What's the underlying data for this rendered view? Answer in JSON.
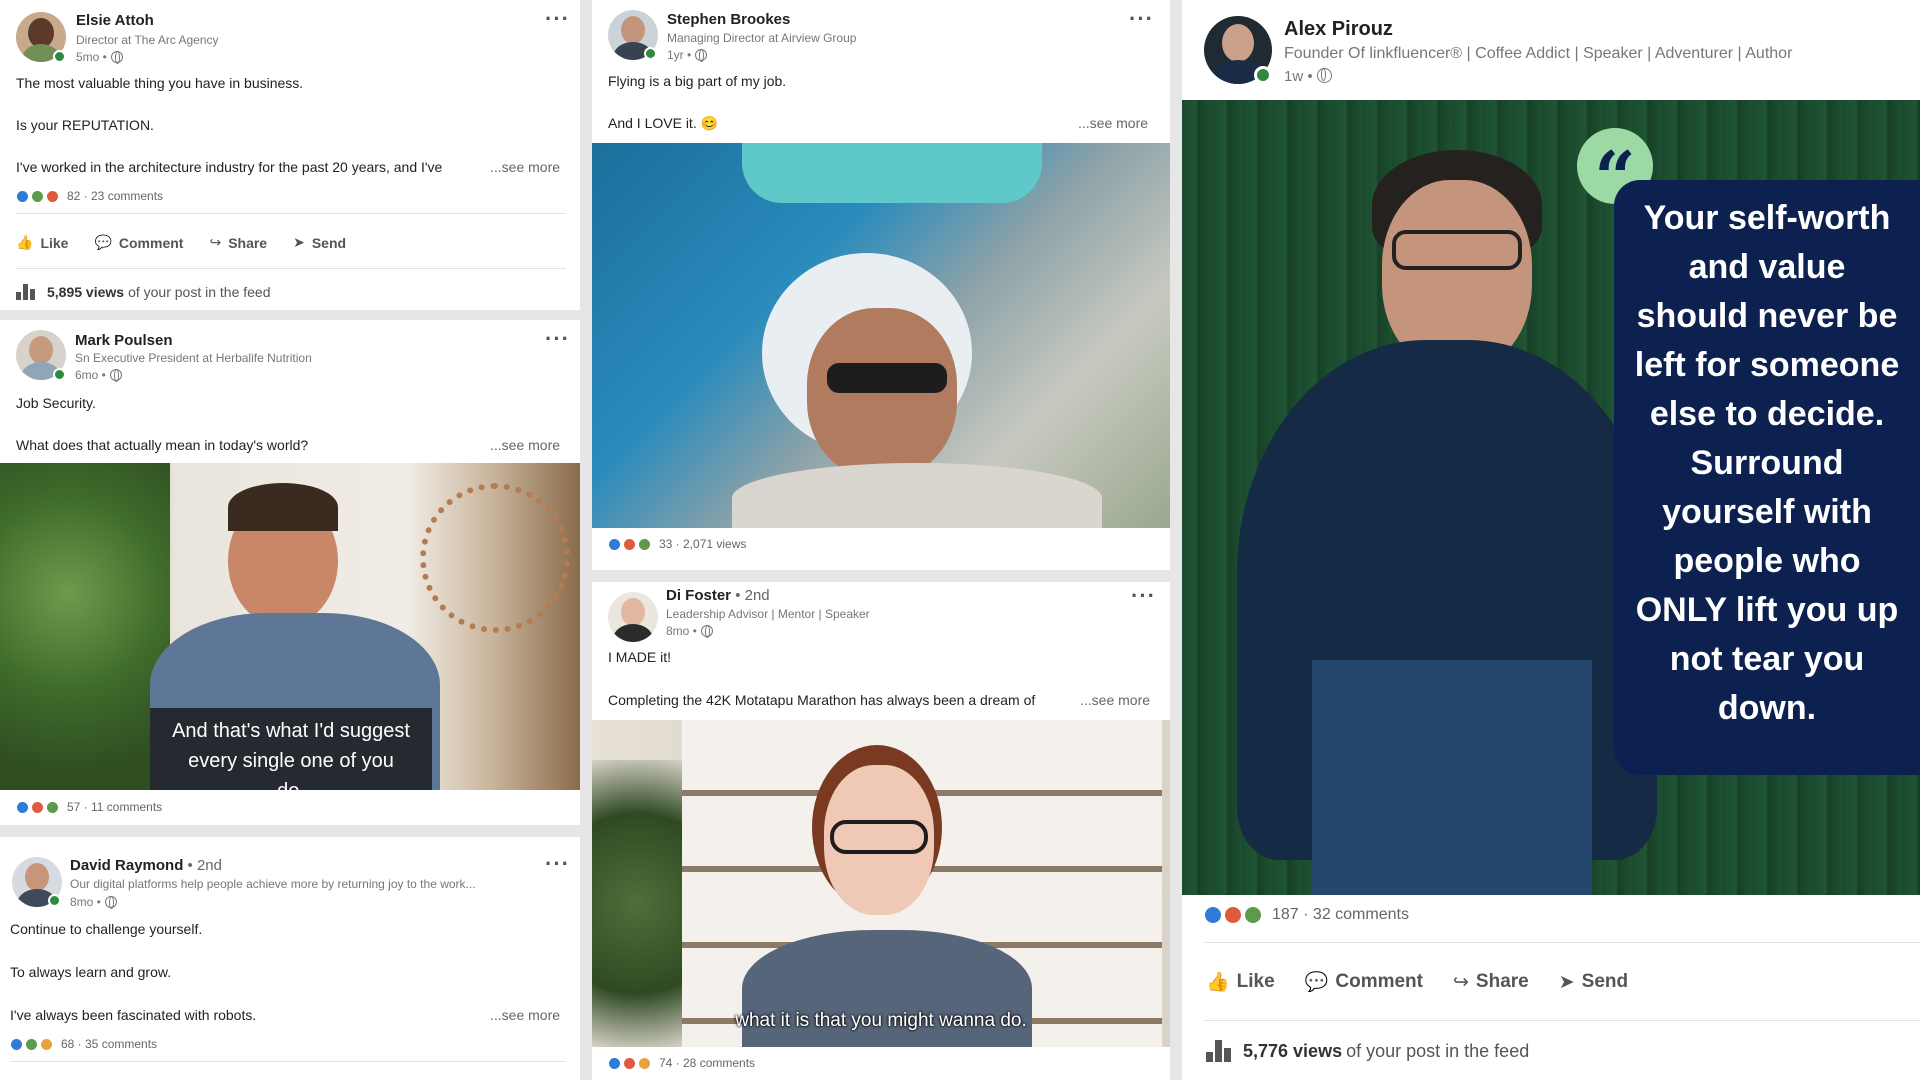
{
  "posts": [
    {
      "name": "Elsie Attoh",
      "headline": "Director at The Arc Agency",
      "time": "5mo •",
      "lines": [
        "The most valuable thing you have in business.",
        "Is your REPUTATION.",
        "I've worked in the architecture industry for the past 20 years, and I've"
      ],
      "see_more": "...see more",
      "reactions": "82 · 23 comments",
      "actions": [
        "Like",
        "Comment",
        "Share",
        "Send"
      ],
      "views_count": "5,895 views",
      "views_suffix": "of your post in the feed"
    },
    {
      "name": "Mark Poulsen",
      "headline": "Sn Executive President at Herbalife Nutrition",
      "time": "6mo •",
      "lines": [
        "Job Security.",
        "What does that actually mean in today's world?"
      ],
      "see_more": "...see more",
      "caption_1": "And that's what I'd suggest",
      "caption_2": "every single one of you do.",
      "reactions": "57 · 11 comments"
    },
    {
      "name": "David Raymond",
      "degree": "• 2nd",
      "headline": "Our digital platforms help people achieve more by returning joy to the work...",
      "time": "8mo •",
      "lines": [
        "Continue to challenge yourself.",
        "To always learn and grow.",
        "I've always been fascinated with robots."
      ],
      "see_more": "...see more",
      "reactions": "68 · 35 comments"
    },
    {
      "name": "Stephen Brookes",
      "headline": "Managing Director at Airview Group",
      "time": "1yr •",
      "lines": [
        "Flying is a big part of my job.",
        "And I LOVE it. 😊"
      ],
      "see_more": "...see more",
      "reactions": "33 · 2,071 views"
    },
    {
      "name": "Di Foster",
      "degree": "• 2nd",
      "headline": "Leadership Advisor | Mentor | Speaker",
      "time": "8mo •",
      "lines": [
        "I MADE it!",
        "Completing the 42K Motatapu Marathon has always been a dream of"
      ],
      "see_more": "...see more",
      "caption": "what it is that you might wanna do.",
      "reactions": "74 · 28 comments"
    },
    {
      "name": "Alex Pirouz",
      "headline": "Founder Of linkfluencer® | Coffee Addict | Speaker | Adventurer | Author",
      "time": "1w •",
      "quote": [
        "Your self-worth",
        "and value",
        "should never be",
        "left for someone",
        "else to decide.",
        "Surround",
        "yourself with",
        "people who",
        "ONLY lift you up",
        "not tear you",
        "down."
      ],
      "reactions": "187 · 32 comments",
      "actions": [
        "Like",
        "Comment",
        "Share",
        "Send"
      ],
      "views_count": "5,776 views",
      "views_suffix": "of your post in the feed"
    }
  ],
  "colors": {
    "online": "#2e8a3e",
    "quote_bg": "#0d2151",
    "quote_mark": "#9cd9a4",
    "like": "#2f7bd8",
    "love": "#e05a3f"
  }
}
